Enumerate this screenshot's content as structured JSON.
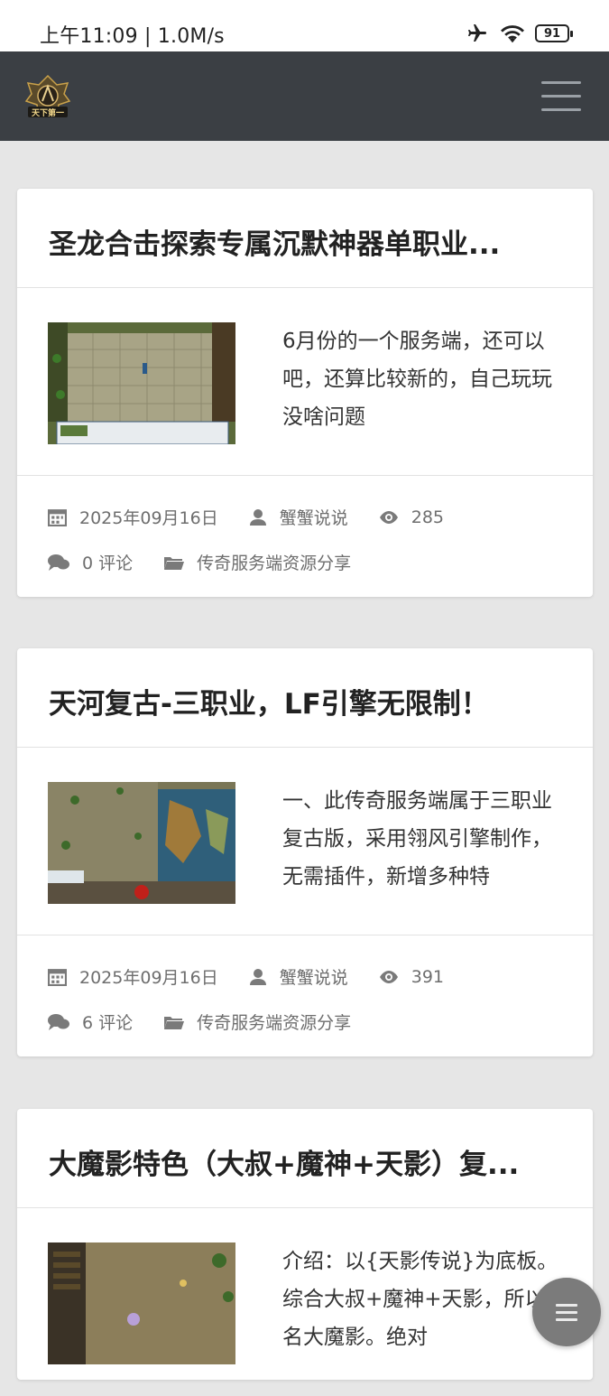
{
  "status_bar": {
    "time": "上午11:09 | 1.0M/s",
    "battery": "91"
  },
  "header": {
    "logo_text": "天下第一"
  },
  "posts": [
    {
      "title": "圣龙合击探索专属沉默神器单职业...",
      "excerpt": "6月份的一个服务端，还可以吧，还算比较新的，自己玩玩没啥问题",
      "date": "2025年09月16日",
      "author": "蟹蟹说说",
      "views": "285",
      "comments": "0 评论",
      "category": "传奇服务端资源分享"
    },
    {
      "title": "天河复古-三职业，LF引擎无限制！",
      "excerpt": "一、此传奇服务端属于三职业复古版，采用翎风引擎制作，无需插件，新增多种特",
      "date": "2025年09月16日",
      "author": "蟹蟹说说",
      "views": "391",
      "comments": "6 评论",
      "category": "传奇服务端资源分享"
    },
    {
      "title": "大魔影特色（大叔+魔神+天影）复...",
      "excerpt": "介绍：以{天影传说}为底板。综合大叔+魔神+天影，所以起名大魔影。绝对"
    }
  ],
  "colors": {
    "header_bg": "#3b3f44",
    "page_bg": "#e6e6e6",
    "card_bg": "#ffffff",
    "meta_text": "#6e6e6e"
  },
  "icons": [
    "airplane-icon",
    "wifi-icon",
    "battery-icon",
    "menu-icon",
    "calendar-icon",
    "user-icon",
    "eye-icon",
    "comments-icon",
    "folder-icon"
  ]
}
